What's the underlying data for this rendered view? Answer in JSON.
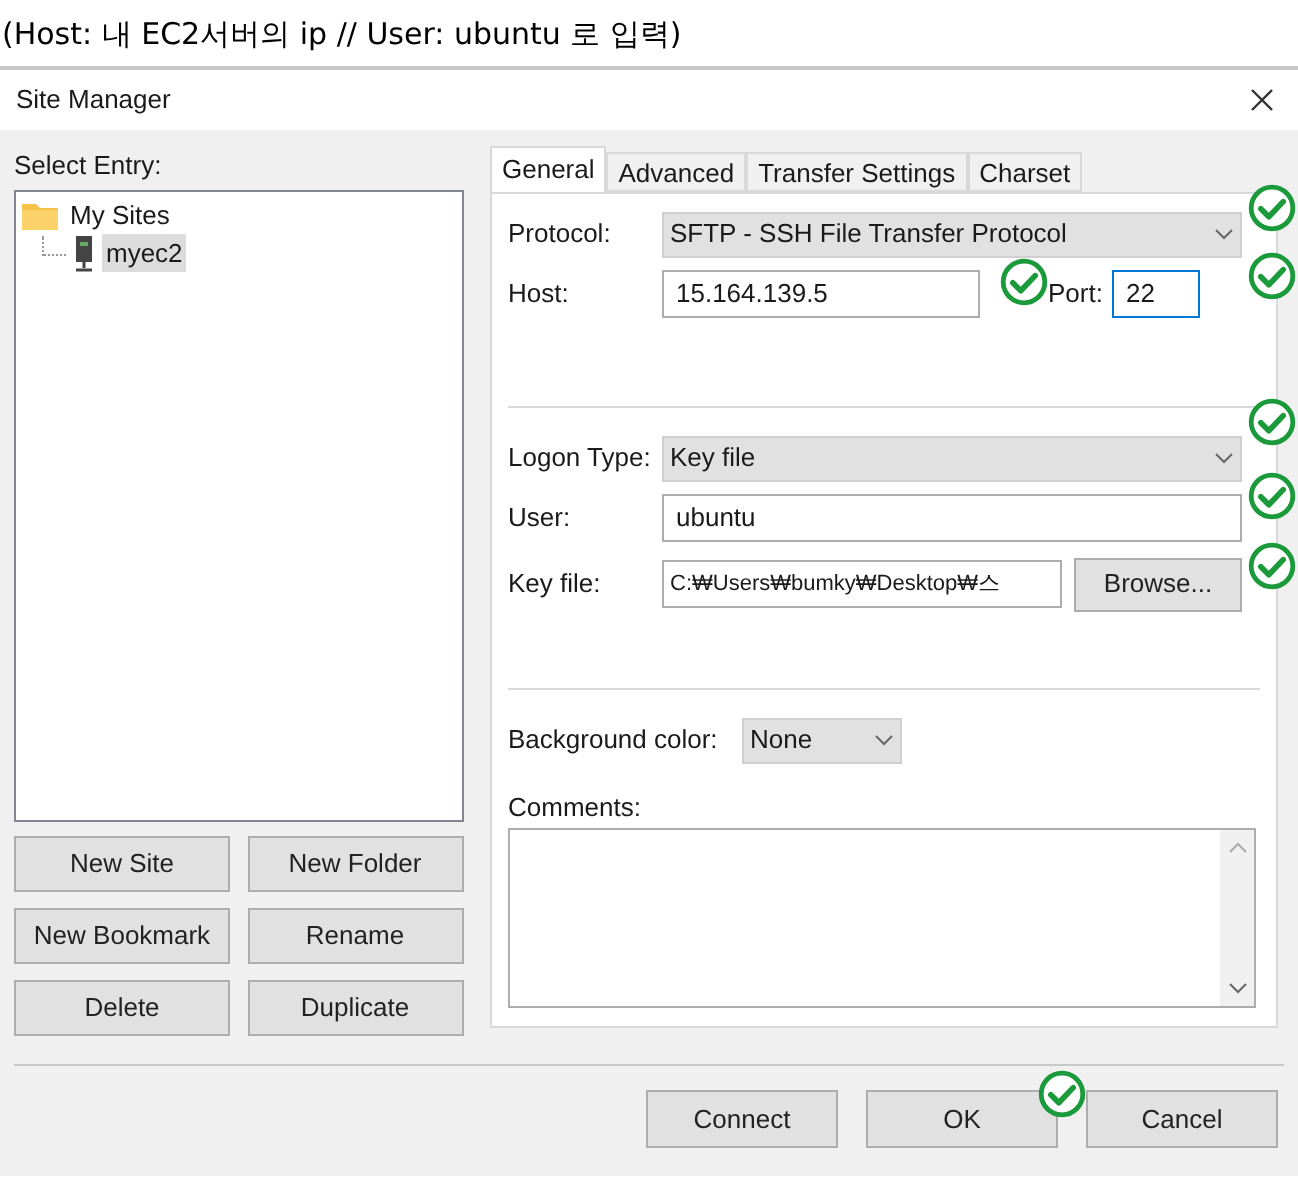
{
  "caption": "(Host: 내 EC2서버의 ip // User: ubuntu 로 입력)",
  "window": {
    "title": "Site Manager"
  },
  "select_entry": {
    "label": "Select Entry:",
    "tree": [
      {
        "label": "My Sites",
        "kind": "folder",
        "selected": false,
        "children": [
          {
            "label": "myec2",
            "kind": "site",
            "selected": true
          }
        ]
      }
    ]
  },
  "site_buttons": [
    "New Site",
    "New Folder",
    "New Bookmark",
    "Rename",
    "Delete",
    "Duplicate"
  ],
  "tabs": [
    {
      "label": "General",
      "selected": true
    },
    {
      "label": "Advanced",
      "selected": false
    },
    {
      "label": "Transfer Settings",
      "selected": false
    },
    {
      "label": "Charset",
      "selected": false
    }
  ],
  "general": {
    "protocol": {
      "label": "Protocol:",
      "value": "SFTP - SSH File Transfer Protocol"
    },
    "host": {
      "label": "Host:",
      "value": "15.164.139.5"
    },
    "port": {
      "label": "Port:",
      "value": "22",
      "focused": true
    },
    "logon_type": {
      "label": "Logon Type:",
      "value": "Key file"
    },
    "user": {
      "label": "User:",
      "value": "ubuntu"
    },
    "key_file": {
      "label": "Key file:",
      "value": "C:₩Users₩bumky₩Desktop₩스",
      "button": "Browse..."
    },
    "background_color": {
      "label": "Background color:",
      "value": "None"
    },
    "comments": {
      "label": "Comments:"
    }
  },
  "footer_buttons": [
    "Connect",
    "OK",
    "Cancel"
  ]
}
